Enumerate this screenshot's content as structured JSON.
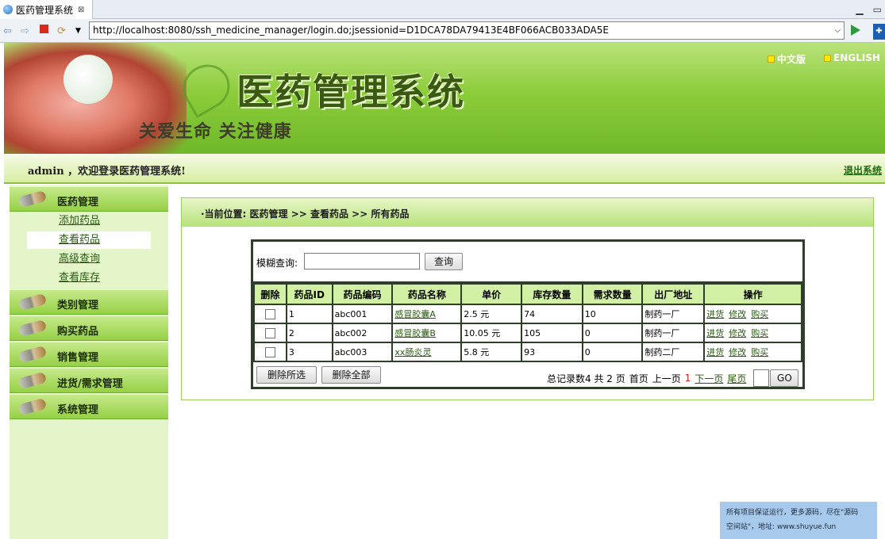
{
  "browser": {
    "tab_title": "医药管理系统",
    "tab_close": "⊠",
    "url": "http://localhost:8080/ssh_medicine_manager/login.do;jsessionid=D1DCA78DA79413E4BF066ACB033ADA5E"
  },
  "banner": {
    "title": "医药管理系统",
    "slogan": "关爱生命  关注健康",
    "lang_cn": "中文版",
    "lang_en": "ENGLISH"
  },
  "welcome": {
    "text": "admin ，欢迎登录医药管理系统!",
    "logout": "退出系统"
  },
  "sidebar": {
    "groups": [
      {
        "label": "医药管理",
        "items": [
          "添加药品",
          "查看药品",
          "高级查询",
          "查看库存"
        ]
      },
      {
        "label": "类别管理"
      },
      {
        "label": "购买药品"
      },
      {
        "label": "销售管理"
      },
      {
        "label": "进货/需求管理"
      },
      {
        "label": "系统管理"
      }
    ],
    "active_item": "查看药品"
  },
  "breadcrumb": "·当前位置:  医药管理 >> 查看药品 >> 所有药品",
  "search": {
    "label": "模糊查询:",
    "value": "",
    "button": "查询"
  },
  "table": {
    "headers": [
      "删除",
      "药品ID",
      "药品编码",
      "药品名称",
      "单价",
      "库存数量",
      "需求数量",
      "出厂地址",
      "操作"
    ],
    "rows": [
      {
        "id": "1",
        "code": "abc001",
        "name": "感冒胶囊A",
        "price": "2.5 元",
        "stock": "74",
        "demand": "10",
        "address": "制药一厂"
      },
      {
        "id": "2",
        "code": "abc002",
        "name": "感冒胶囊B",
        "price": "10.05 元",
        "stock": "105",
        "demand": "0",
        "address": "制药一厂"
      },
      {
        "id": "3",
        "code": "abc003",
        "name": "xx肠炎灵",
        "price": "5.8 元",
        "stock": "93",
        "demand": "0",
        "address": "制药二厂"
      }
    ],
    "ops": [
      "进货",
      "修改",
      "购买"
    ]
  },
  "actions": {
    "delete_selected": "删除所选",
    "delete_all": "删除全部"
  },
  "pager": {
    "total": "总记录数4 共 2 页",
    "first": "首页",
    "prev": "上一页",
    "current": "1",
    "next": "下一页",
    "last": "尾页",
    "go": "GO"
  },
  "footnote": {
    "line1": "所有项目保证运行，更多源码，尽在\"源码",
    "line2": "空间站\"，地址: www.shuyue.fun"
  }
}
